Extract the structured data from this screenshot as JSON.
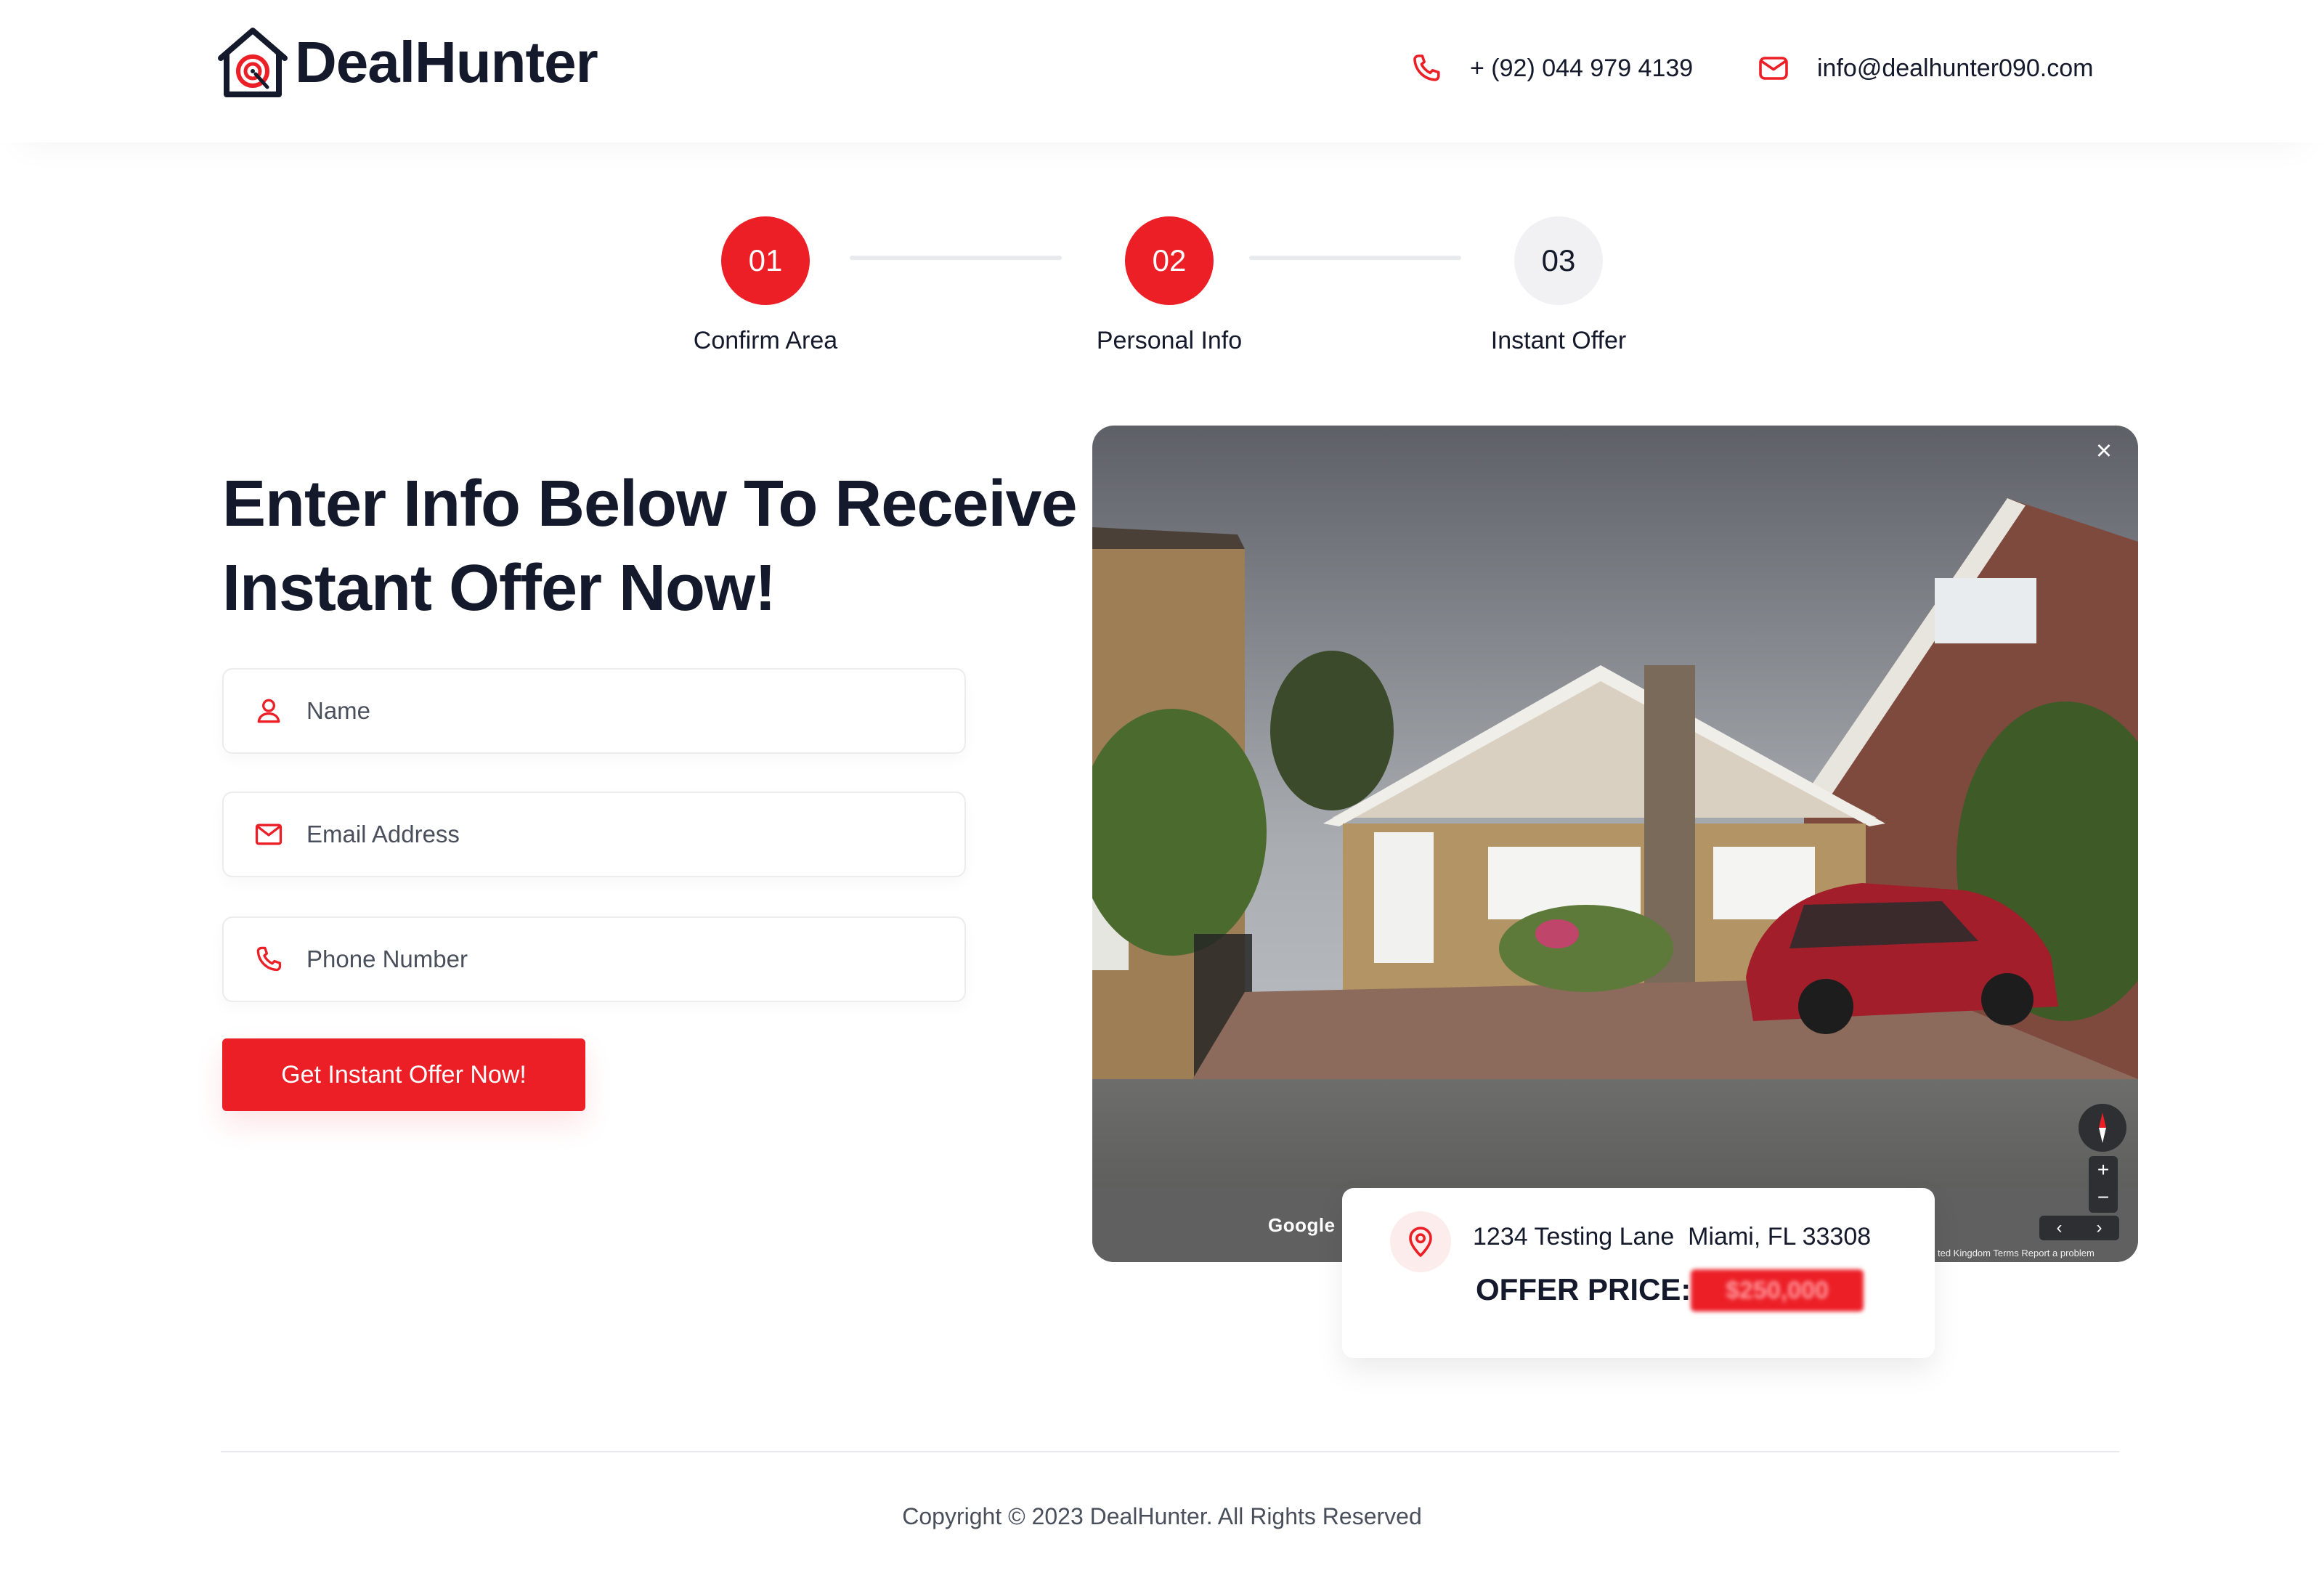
{
  "brand": {
    "name": "DealHunter",
    "accent": "#ec1f27",
    "text_color": "#141a2b"
  },
  "header": {
    "phone": "+ (92) 044 979 4139",
    "email": "info@dealhunter090.com"
  },
  "steps": [
    {
      "number": "01",
      "label": "Confirm Area",
      "state": "complete"
    },
    {
      "number": "02",
      "label": "Personal Info",
      "state": "active"
    },
    {
      "number": "03",
      "label": "Instant Offer",
      "state": "pending"
    }
  ],
  "form": {
    "heading_line1": "Enter Info Below To Receive",
    "heading_line2": "Instant Offer Now!",
    "name_placeholder": "Name",
    "email_placeholder": "Email Address",
    "phone_placeholder": "Phone Number",
    "submit_label": "Get Instant Offer Now!"
  },
  "street_view": {
    "close_label": "×",
    "provider_label": "Google",
    "zoom_in": "+",
    "zoom_out": "−",
    "prev": "‹",
    "next": "›",
    "attribution": "ted Kingdom   Terms   Report a problem"
  },
  "offer_card": {
    "address": "1234 Testing Lane  Miami, FL 33308",
    "offer_label": "OFFER PRICE:",
    "offer_value": "$250,000"
  },
  "footer": {
    "copyright": "Copyright © 2023 DealHunter. All Rights Reserved"
  },
  "icons": {
    "logo": "house-target-icon",
    "phone": "phone-icon",
    "email": "envelope-icon",
    "user": "user-icon",
    "pin": "map-pin-icon"
  }
}
